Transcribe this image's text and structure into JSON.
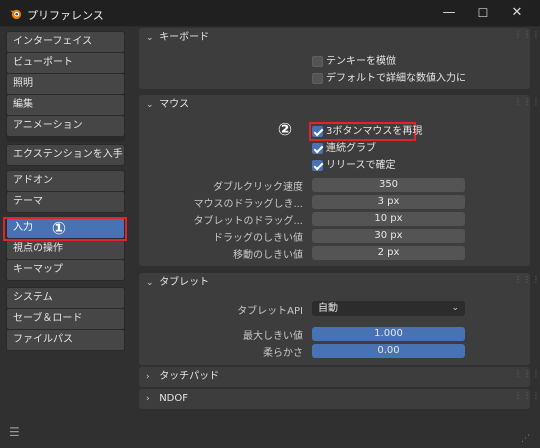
{
  "window": {
    "title": "プリファレンス",
    "controls": [
      "—",
      "☐",
      "✕"
    ]
  },
  "nav": {
    "groups": [
      [
        "インターフェイス",
        "ビューポート",
        "照明",
        "編集",
        "アニメーション"
      ],
      [
        "エクステンションを入手"
      ],
      [
        "アドオン",
        "テーマ"
      ],
      [
        "入力",
        "視点の操作",
        "キーマップ"
      ],
      [
        "システム",
        "セーブ＆ロード",
        "ファイルパス"
      ]
    ],
    "active": "入力"
  },
  "keyboard": {
    "header": "キーボード",
    "options": [
      {
        "label": "テンキーを模倣",
        "checked": false
      },
      {
        "label": "デフォルトで詳細な数値入力に",
        "checked": false
      }
    ]
  },
  "mouse": {
    "header": "マウス",
    "options": [
      {
        "label": "3ボタンマウスを再現",
        "checked": true
      },
      {
        "label": "連続グラブ",
        "checked": true
      },
      {
        "label": "リリースで確定",
        "checked": true
      }
    ],
    "fields": [
      {
        "label": "ダブルクリック速度",
        "value": "350"
      },
      {
        "label": "マウスのドラッグしき...",
        "value": "3 px"
      },
      {
        "label": "タブレットのドラッグ...",
        "value": "10 px"
      },
      {
        "label": "ドラッグのしきい値",
        "value": "30 px"
      },
      {
        "label": "移動のしきい値",
        "value": "2 px"
      }
    ]
  },
  "tablet": {
    "header": "タブレット",
    "api_label": "タブレットAPI",
    "api_value": "自動",
    "sliders": [
      {
        "label": "最大しきい値",
        "value": "1.000",
        "fraction": 1.0
      },
      {
        "label": "柔らかさ",
        "value": "0.00",
        "fraction": 0.0
      }
    ]
  },
  "collapsed_sections": [
    "タッチパッド",
    "NDOF"
  ],
  "annotations": {
    "callout_1": "①",
    "callout_2": "②",
    "color": "#e0242b"
  },
  "icons": {
    "app": "blender-logo-icon",
    "menu": "hamburger-menu-icon",
    "expanded": "chevron-down-icon",
    "collapsed": "chevron-right-icon"
  }
}
